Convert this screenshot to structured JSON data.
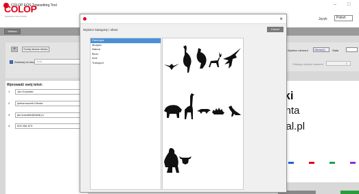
{
  "window": {
    "title": "COLOP EOS Typesetting Tool",
    "minimize": "–",
    "maximize": "□"
  },
  "header": {
    "brand": "COLOP",
    "brand_sub": "MARKING SOLUTIONS",
    "language_label": "Język",
    "language_value": "Polish"
  },
  "toolbar": {
    "back_label": "Wstecz"
  },
  "left": {
    "add_text_icon": "+",
    "add_text_label": "Dodaj obszar tekstu",
    "apply_all_label": "Zastosuj do wszystkiego",
    "apply_all_placeholder": "Arial"
  },
  "text_lines": {
    "title": "Wprowadź swój tekst:",
    "lines": [
      {
        "num": "1",
        "value": "Jan Kowalski"
      },
      {
        "num": "2",
        "value": "pieksmosznik Klienta"
      },
      {
        "num": "3",
        "value": "jan.kowalski@detal.pl"
      },
      {
        "num": "4",
        "value": "503 256 873"
      }
    ]
  },
  "right": {
    "select_element_label": "Wybierz element",
    "select_element_value": "Obraz(1)",
    "status_label": "Stała",
    "spacing_label": "Odstępy między znakami",
    "spacing_value": "0"
  },
  "preview": {
    "lines": [
      "ski",
      "ienta",
      "etal.pl",
      "3"
    ]
  },
  "colors": {
    "brand": "#e2001a",
    "selected": "#4a90d9",
    "swatches": [
      "#1f5fd6",
      "#e2001a",
      "#1a9e5c",
      "#8a2be2"
    ]
  },
  "dialog": {
    "heading": "Wybierz kategorię i obraz",
    "cancel_label": "Cancel",
    "close": "×",
    "categories": [
      {
        "label": "Zwierzęta",
        "selected": true
      },
      {
        "label": "Muzyka",
        "selected": false
      },
      {
        "label": "Natura",
        "selected": false
      },
      {
        "label": "Biuro",
        "selected": false
      },
      {
        "label": "Inne",
        "selected": false
      },
      {
        "label": "Transport",
        "selected": false
      }
    ],
    "images": [
      "bird-icon",
      "cormorant-icon",
      "vulture-icon",
      "deer-icon",
      "eagle-icon",
      "buffalo-icon",
      "giraffe-icon",
      "crocodile-icon",
      "hedgehog-icon",
      "kangaroo-icon",
      "gorilla-icon",
      "bull-head-icon"
    ]
  }
}
